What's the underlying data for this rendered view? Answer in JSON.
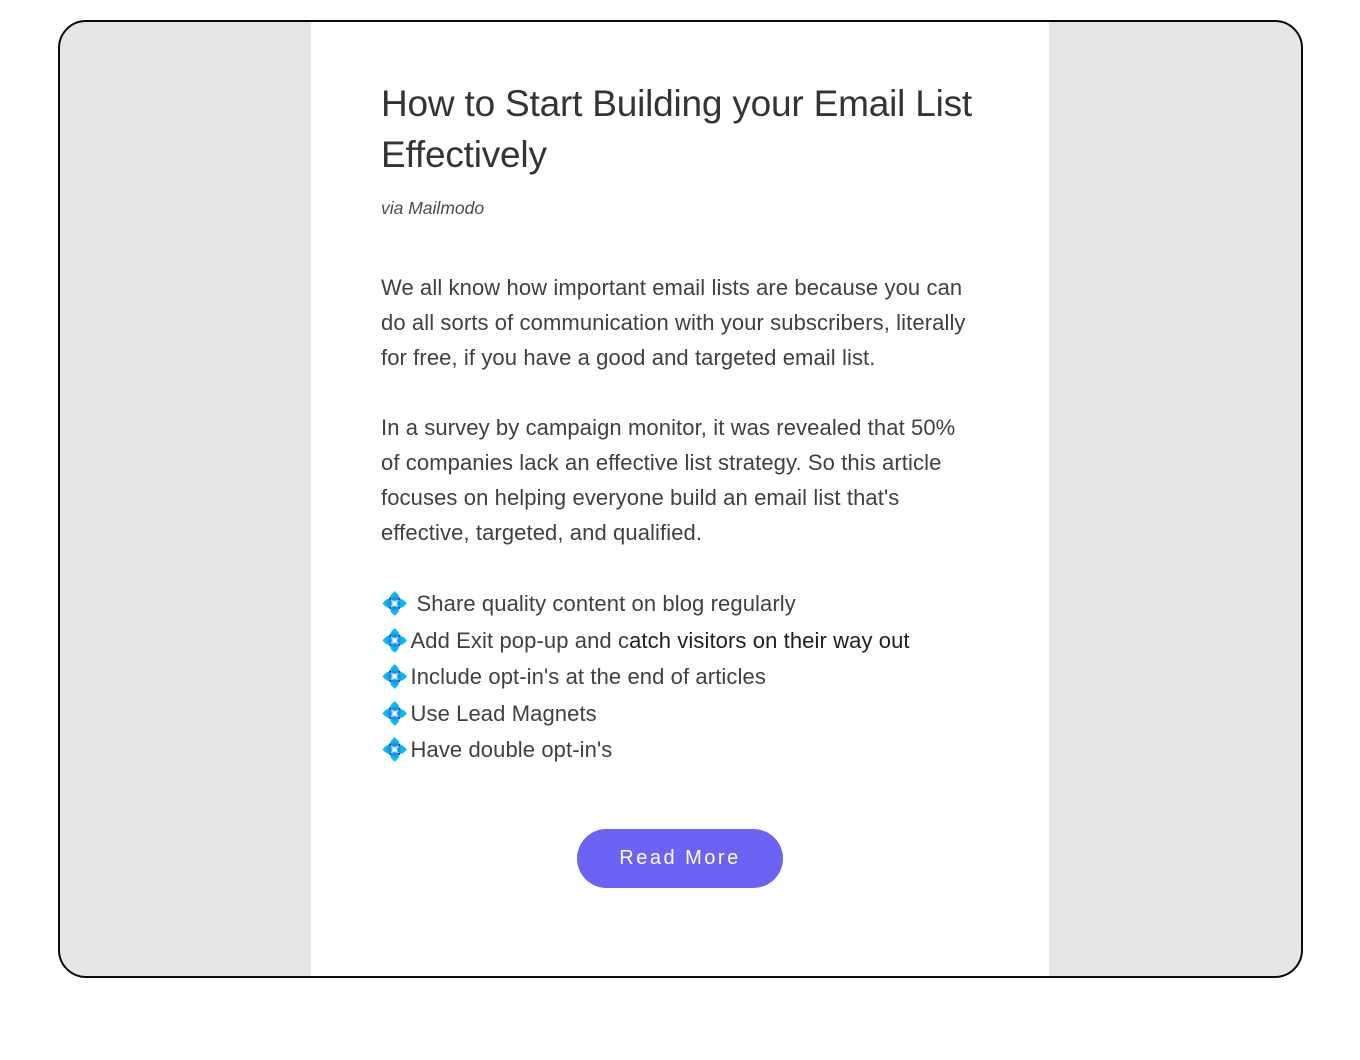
{
  "article": {
    "title": "How to Start Building your Email List Effectively",
    "source": "via Mailmodo",
    "paragraph1": "We all know how important email lists are because you can do all sorts of communication with your subscribers, literally for free, if you have a good and targeted email list.",
    "paragraph2": "In a survey by campaign monitor, it was revealed that 50% of companies lack an effective list strategy. So this article focuses on helping everyone build an email list that's effective, targeted, and qualified.",
    "bullets": [
      {
        "icon": "💠",
        "text": "Share quality content on blog regularly",
        "tail_dark": ""
      },
      {
        "icon": "💠",
        "text": "Add Exit pop-up and c",
        "tail_dark": "atch visitors on their way out"
      },
      {
        "icon": "💠",
        "text": "Include opt-in's at the end of articles",
        "tail_dark": ""
      },
      {
        "icon": "💠",
        "text": "Use Lead Magnets",
        "tail_dark": ""
      },
      {
        "icon": "💠",
        "text": "Have double opt-in's",
        "tail_dark": ""
      }
    ],
    "cta_label": "Read More"
  }
}
